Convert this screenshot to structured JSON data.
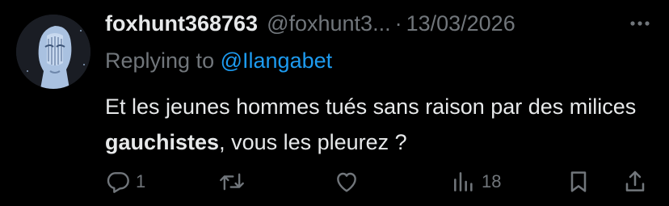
{
  "tweet": {
    "display_name": "foxhunt368763",
    "handle": "@foxhunt3...",
    "separator": "·",
    "date": "13/03/2026",
    "replying_prefix": "Replying to",
    "replying_to": "@Ilangabet",
    "text_part1": "Et les jeunes hommes tués sans raison par des milices ",
    "text_bold": "gauchistes",
    "text_part2": ", vous les pleurez ?",
    "more_icon": "ellipsis-icon",
    "avatar_icon": "blue-statue-head-avatar"
  },
  "actions": {
    "reply_count": "1",
    "retweet_count": "",
    "like_count": "",
    "views_count": "18"
  },
  "colors": {
    "background": "#000000",
    "text": "#e7e9ea",
    "muted": "#71767b",
    "link": "#1d9bf0"
  }
}
